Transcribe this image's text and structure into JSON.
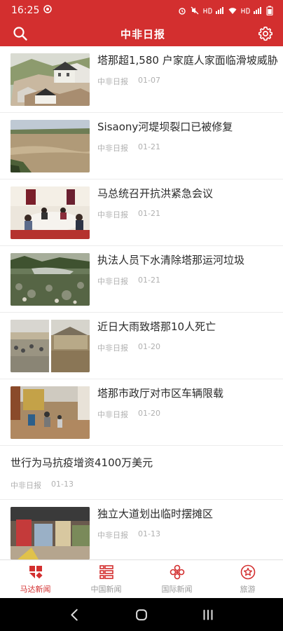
{
  "status_bar": {
    "time": "16:25"
  },
  "header": {
    "title": "中非日报"
  },
  "articles": [
    {
      "title": "塔那超1,580 户家庭人家面临滑坡威胁",
      "source": "中非日报",
      "date": "01-07"
    },
    {
      "title": "Sisaony河堤坝裂口已被修复",
      "source": "中非日报",
      "date": "01-21"
    },
    {
      "title": "马总统召开抗洪紧急会议",
      "source": "中非日报",
      "date": "01-21"
    },
    {
      "title": "执法人员下水清除塔那运河垃圾",
      "source": "中非日报",
      "date": "01-21"
    },
    {
      "title": "近日大雨致塔那10人死亡",
      "source": "中非日报",
      "date": "01-20"
    },
    {
      "title": "塔那市政厅对市区车辆限载",
      "source": "中非日报",
      "date": "01-20"
    },
    {
      "title": "世行为马抗疫增资4100万美元",
      "source": "中非日报",
      "date": "01-13"
    },
    {
      "title": "独立大道划出临时摆摊区",
      "source": "中非日报",
      "date": "01-13"
    }
  ],
  "bottom_nav": [
    {
      "label": "马达新闻",
      "icon": "madagascar-news-icon",
      "active": true
    },
    {
      "label": "中国新闻",
      "icon": "china-news-icon",
      "active": false
    },
    {
      "label": "国际新闻",
      "icon": "world-news-icon",
      "active": false
    },
    {
      "label": "旅游",
      "icon": "travel-icon",
      "active": false
    }
  ],
  "colors": {
    "accent": "#d32f2f",
    "muted": "#9a9a9a",
    "meta": "#b0b0b0"
  }
}
